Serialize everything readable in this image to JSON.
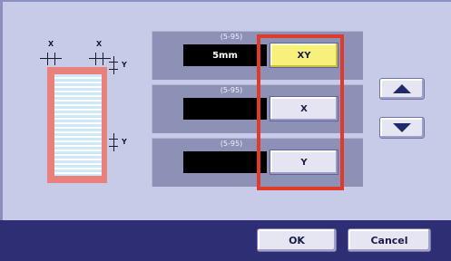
{
  "rows": [
    {
      "label": "(5-95)",
      "value": "5mm",
      "button": "XY",
      "selected": true
    },
    {
      "label": "(5-95)",
      "value": "",
      "button": "X",
      "selected": false
    },
    {
      "label": "(5-95)",
      "value": "",
      "button": "Y",
      "selected": false
    }
  ],
  "diagram": {
    "x_label": "X",
    "y_label": "Y"
  },
  "footer": {
    "ok_label": "OK",
    "cancel_label": "Cancel"
  },
  "colors": {
    "highlight": "#e03a2a",
    "selected_button": "#f7f07a",
    "footer_bar": "#2e2e74"
  },
  "icons": {
    "up": "triangle-up-icon",
    "down": "triangle-down-icon"
  }
}
